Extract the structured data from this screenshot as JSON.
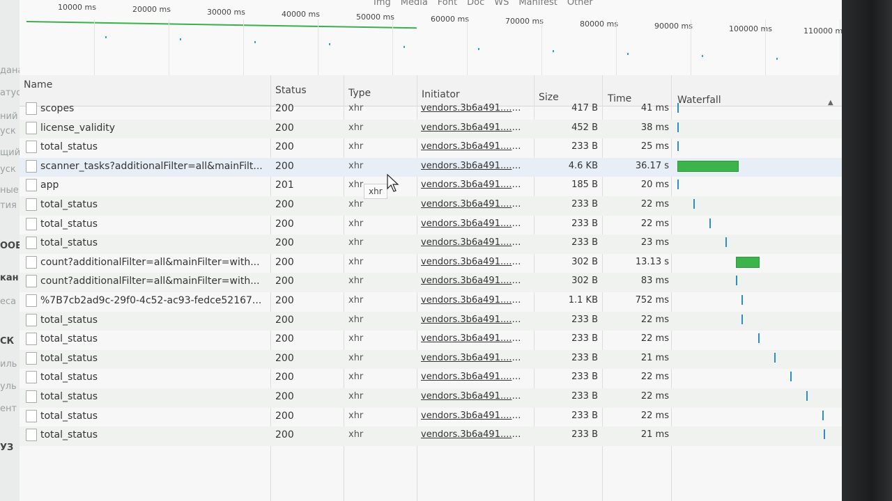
{
  "left_page_fragments": [
    {
      "text": "дана",
      "bold": false
    },
    {
      "text": "атус",
      "bold": false
    },
    {
      "text": "ний",
      "bold": false
    },
    {
      "text": "уск",
      "bold": false
    },
    {
      "text": "щий",
      "bold": false
    },
    {
      "text": "уск",
      "bold": false
    },
    {
      "text": "ные",
      "bold": false
    },
    {
      "text": "тия",
      "bold": false
    },
    {
      "text": "ООЕ",
      "bold": true
    },
    {
      "text": "кан",
      "bold": true
    },
    {
      "text": "еса",
      "bold": false
    },
    {
      "text": "СК",
      "bold": true
    },
    {
      "text": "иль",
      "bold": false
    },
    {
      "text": "уль",
      "bold": false
    },
    {
      "text": "ент",
      "bold": false
    },
    {
      "text": "УЗ",
      "bold": true
    }
  ],
  "filters": [
    "Img",
    "Media",
    "Font",
    "Doc",
    "WS",
    "Manifest",
    "Other"
  ],
  "overview_ticks": [
    "10000 ms",
    "20000 ms",
    "30000 ms",
    "40000 ms",
    "50000 ms",
    "60000 ms",
    "70000 ms",
    "80000 ms",
    "90000 ms",
    "100000 ms",
    "110000 m"
  ],
  "columns": {
    "name": "Name",
    "status": "Status",
    "type": "Type",
    "initiator": "Initiator",
    "size": "Size",
    "time": "Time",
    "waterfall": "Waterfall"
  },
  "sort_indicator": "▲",
  "tooltip": "xhr",
  "rows": [
    {
      "name": "scopes",
      "status": "200",
      "type": "xhr",
      "initiator": "vendors.3b6a491....a...",
      "size": "417 B",
      "time": "41 ms",
      "wf_start": 0.0,
      "wf_dur": 0.0
    },
    {
      "name": "license_validity",
      "status": "200",
      "type": "xhr",
      "initiator": "vendors.3b6a491....a...",
      "size": "452 B",
      "time": "38 ms",
      "wf_start": 0.0,
      "wf_dur": 0.0
    },
    {
      "name": "total_status",
      "status": "200",
      "type": "xhr",
      "initiator": "vendors.3b6a491....a...",
      "size": "233 B",
      "time": "25 ms",
      "wf_start": 0.0,
      "wf_dur": 0.0
    },
    {
      "name": "scanner_tasks?additionalFilter=all&mainFilt...",
      "status": "200",
      "type": "xhr",
      "initiator": "vendors.3b6a491....a...",
      "size": "4.6 KB",
      "time": "36.17 s",
      "wf_start": 0.0,
      "wf_dur": 0.41
    },
    {
      "name": "app",
      "status": "201",
      "type": "xhr",
      "initiator": "vendors.3b6a491....a...",
      "size": "185 B",
      "time": "20 ms",
      "wf_start": 0.0,
      "wf_dur": 0.0
    },
    {
      "name": "total_status",
      "status": "200",
      "type": "xhr",
      "initiator": "vendors.3b6a491....a...",
      "size": "233 B",
      "time": "22 ms",
      "wf_start": 0.11,
      "wf_dur": 0.0
    },
    {
      "name": "total_status",
      "status": "200",
      "type": "xhr",
      "initiator": "vendors.3b6a491....a...",
      "size": "233 B",
      "time": "22 ms",
      "wf_start": 0.22,
      "wf_dur": 0.0
    },
    {
      "name": "total_status",
      "status": "200",
      "type": "xhr",
      "initiator": "vendors.3b6a491....a...",
      "size": "233 B",
      "time": "23 ms",
      "wf_start": 0.33,
      "wf_dur": 0.0
    },
    {
      "name": "count?additionalFilter=all&mainFilter=with...",
      "status": "200",
      "type": "xhr",
      "initiator": "vendors.3b6a491....a...",
      "size": "302 B",
      "time": "13.13 s",
      "wf_start": 0.4,
      "wf_dur": 0.15
    },
    {
      "name": "count?additionalFilter=all&mainFilter=with...",
      "status": "200",
      "type": "xhr",
      "initiator": "vendors.3b6a491....a...",
      "size": "302 B",
      "time": "83 ms",
      "wf_start": 0.4,
      "wf_dur": 0.0
    },
    {
      "name": "%7B7cb2ad9c-29f0-4c52-ac93-fedce52167...",
      "status": "200",
      "type": "xhr",
      "initiator": "vendors.3b6a491....a...",
      "size": "1.1 KB",
      "time": "752 ms",
      "wf_start": 0.44,
      "wf_dur": 0.0
    },
    {
      "name": "total_status",
      "status": "200",
      "type": "xhr",
      "initiator": "vendors.3b6a491....a...",
      "size": "233 B",
      "time": "22 ms",
      "wf_start": 0.44,
      "wf_dur": 0.0
    },
    {
      "name": "total_status",
      "status": "200",
      "type": "xhr",
      "initiator": "vendors.3b6a491....a...",
      "size": "233 B",
      "time": "22 ms",
      "wf_start": 0.55,
      "wf_dur": 0.0
    },
    {
      "name": "total_status",
      "status": "200",
      "type": "xhr",
      "initiator": "vendors.3b6a491....a...",
      "size": "233 B",
      "time": "21 ms",
      "wf_start": 0.66,
      "wf_dur": 0.0
    },
    {
      "name": "total_status",
      "status": "200",
      "type": "xhr",
      "initiator": "vendors.3b6a491....a...",
      "size": "233 B",
      "time": "22 ms",
      "wf_start": 0.77,
      "wf_dur": 0.0
    },
    {
      "name": "total_status",
      "status": "200",
      "type": "xhr",
      "initiator": "vendors.3b6a491....a...",
      "size": "233 B",
      "time": "22 ms",
      "wf_start": 0.88,
      "wf_dur": 0.0
    },
    {
      "name": "total_status",
      "status": "200",
      "type": "xhr",
      "initiator": "vendors.3b6a491....a...",
      "size": "233 B",
      "time": "22 ms",
      "wf_start": 0.99,
      "wf_dur": 0.0
    },
    {
      "name": "total_status",
      "status": "200",
      "type": "xhr",
      "initiator": "vendors.3b6a491....a...",
      "size": "233 B",
      "time": "21 ms",
      "wf_start": 1.0,
      "wf_dur": 0.0
    }
  ],
  "colors": {
    "waterfall_waiting": "#2a8fc0",
    "waterfall_download": "#3cb44b",
    "overview_line": "#3ab04a"
  }
}
